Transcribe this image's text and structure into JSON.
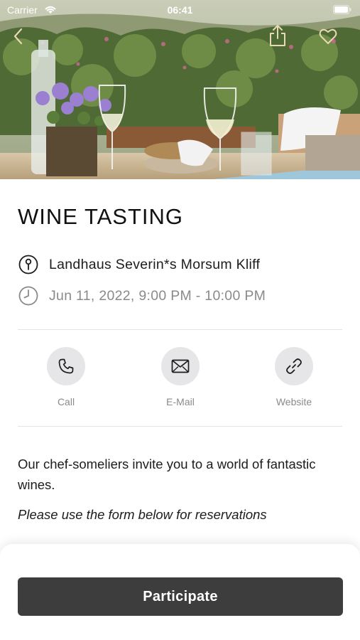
{
  "status_bar": {
    "carrier": "Carrier",
    "time": "06:41",
    "icons": [
      "wifi-icon",
      "battery-icon"
    ]
  },
  "nav": {
    "icons": [
      "chevron-left-icon",
      "share-icon",
      "heart-icon"
    ]
  },
  "event": {
    "title": "WINE TASTING",
    "venue": "Landhaus Severin*s Morsum Kliff",
    "datetime": "Jun 11, 2022, 9:00 PM - 10:00 PM"
  },
  "contact": [
    {
      "label": "Call",
      "icon": "phone-icon"
    },
    {
      "label": "E-Mail",
      "icon": "envelope-icon"
    },
    {
      "label": "Website",
      "icon": "link-icon"
    }
  ],
  "description": "Our chef-someliers invite you to a world of fantastic wines.",
  "note": "Please use the form below for reservations",
  "cta": {
    "label": "Participate"
  },
  "colors": {
    "button_bg": "#3d3d3d",
    "icon_circle_bg": "#e6e6e8",
    "muted_text": "#8a8a8e",
    "divider": "#e3e3e6"
  }
}
